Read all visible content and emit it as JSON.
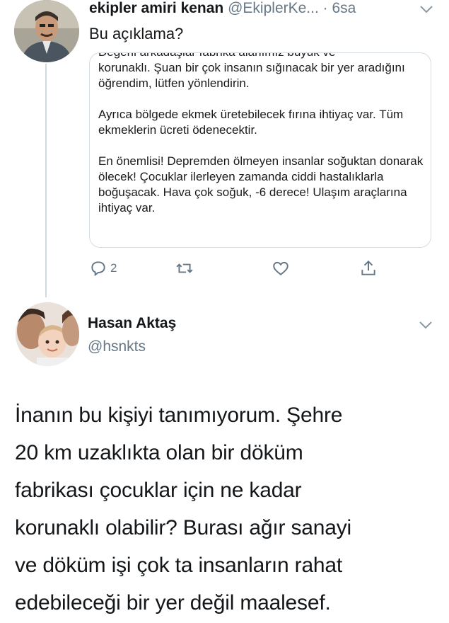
{
  "tweet1": {
    "display_name": "ekipler amiri kenan",
    "handle": "@EkiplerKe...",
    "time": "· 6sa",
    "text": "Bu açıklama?",
    "quote": {
      "cut_line": "Değerli arkadaşlar fabrika alanımız büyük ve",
      "p1": "korunaklı. Şuan bir çok insanın sığınacak bir yer aradığını öğrendim, lütfen yönlendirin.",
      "p2": "Ayrıca bölgede ekmek üretebilecek fırına ihtiyaç var. Tüm ekmeklerin ücreti ödenecektir.",
      "p3": "En önemlisi! Depremden ölmeyen insanlar soğuktan donarak ölecek! Çocuklar ilerleyen zamanda ciddi hastalıklarla boğuşacak. Hava çok soğuk, -6 derece! Ulaşım araçlarına ihtiyaç var."
    },
    "actions": {
      "reply_count": "2",
      "icons": [
        "reply-icon",
        "retweet-icon",
        "like-icon",
        "share-icon"
      ]
    }
  },
  "tweet2": {
    "display_name": "Hasan Aktaş",
    "handle": "@hsnkts",
    "text": "İnanın bu kişiyi tanımıyorum. Şehre\n20 km uzaklıkta olan bir döküm\nfabrikası çocuklar için ne kadar\nkorunaklı olabilir? Burası ağır sanayi\nve döküm işi çok ta insanların rahat\nedebileceği bir yer  değil maalesef."
  },
  "colors": {
    "text_primary": "#14171a",
    "text_secondary": "#657786",
    "border": "#d5dde2",
    "thread_line": "#cfd9de"
  }
}
